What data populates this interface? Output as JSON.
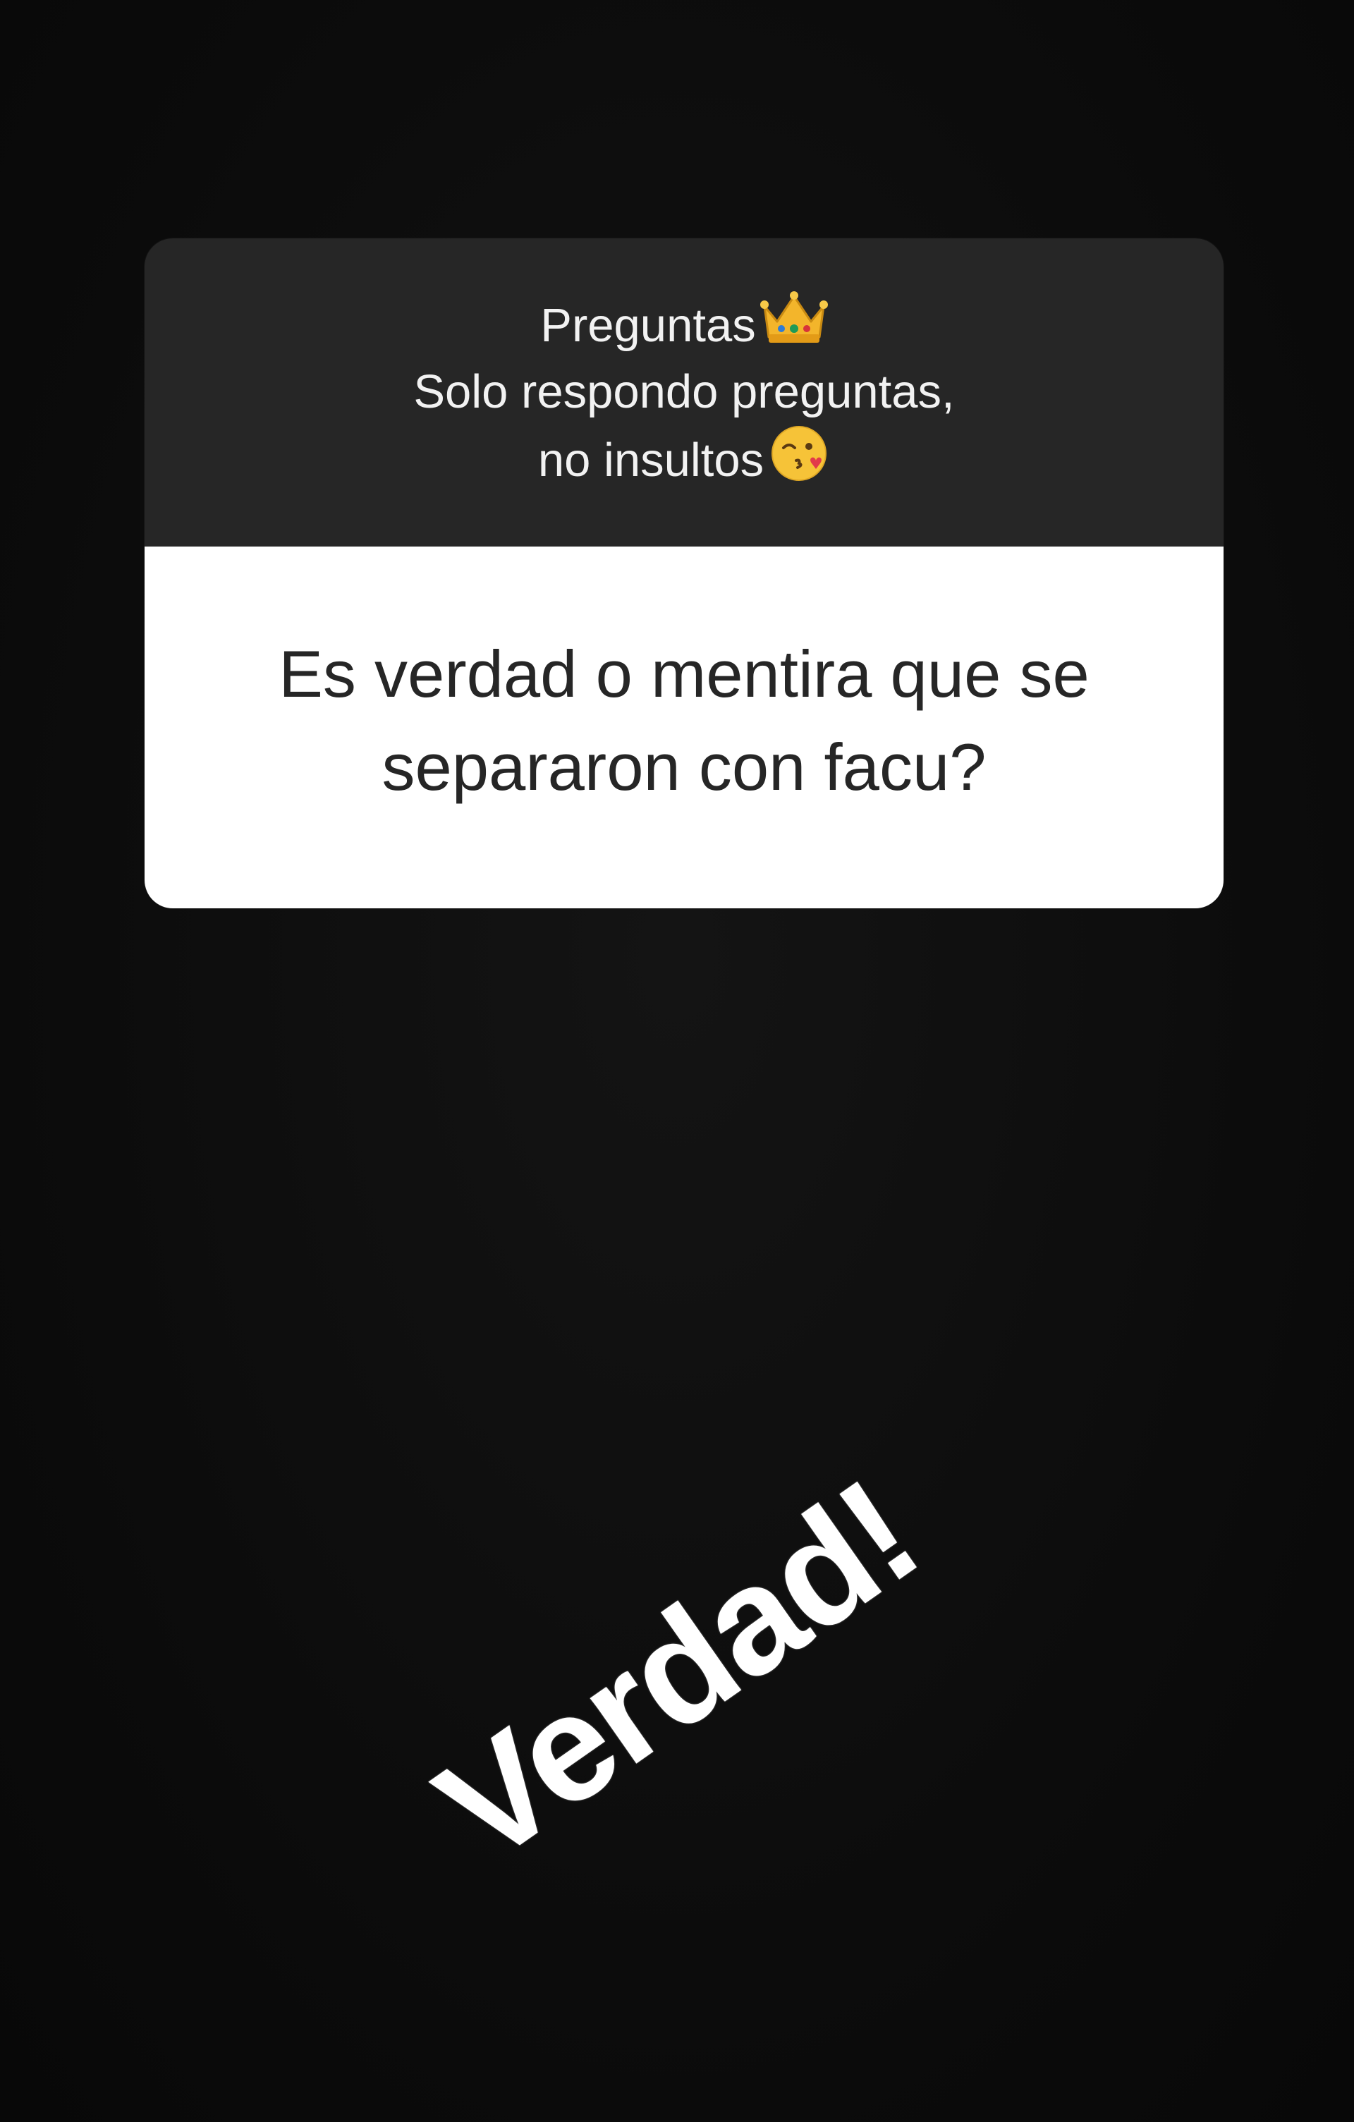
{
  "question_sticker": {
    "header": {
      "title": "Preguntas",
      "title_icon": "crown-emoji",
      "subtitle_line1": "Solo respondo preguntas,",
      "subtitle_line2": "no insultos",
      "subtitle_icon": "kissing-face-emoji"
    },
    "question_line1": "Es verdad o mentira que se",
    "question_line2": "separaron con facu?"
  },
  "answer": {
    "text": "Verdad!"
  },
  "colors": {
    "background": "#0d0d0d",
    "header_bg": "#262626",
    "body_bg": "#ffffff",
    "answer_text": "#ffffff"
  }
}
